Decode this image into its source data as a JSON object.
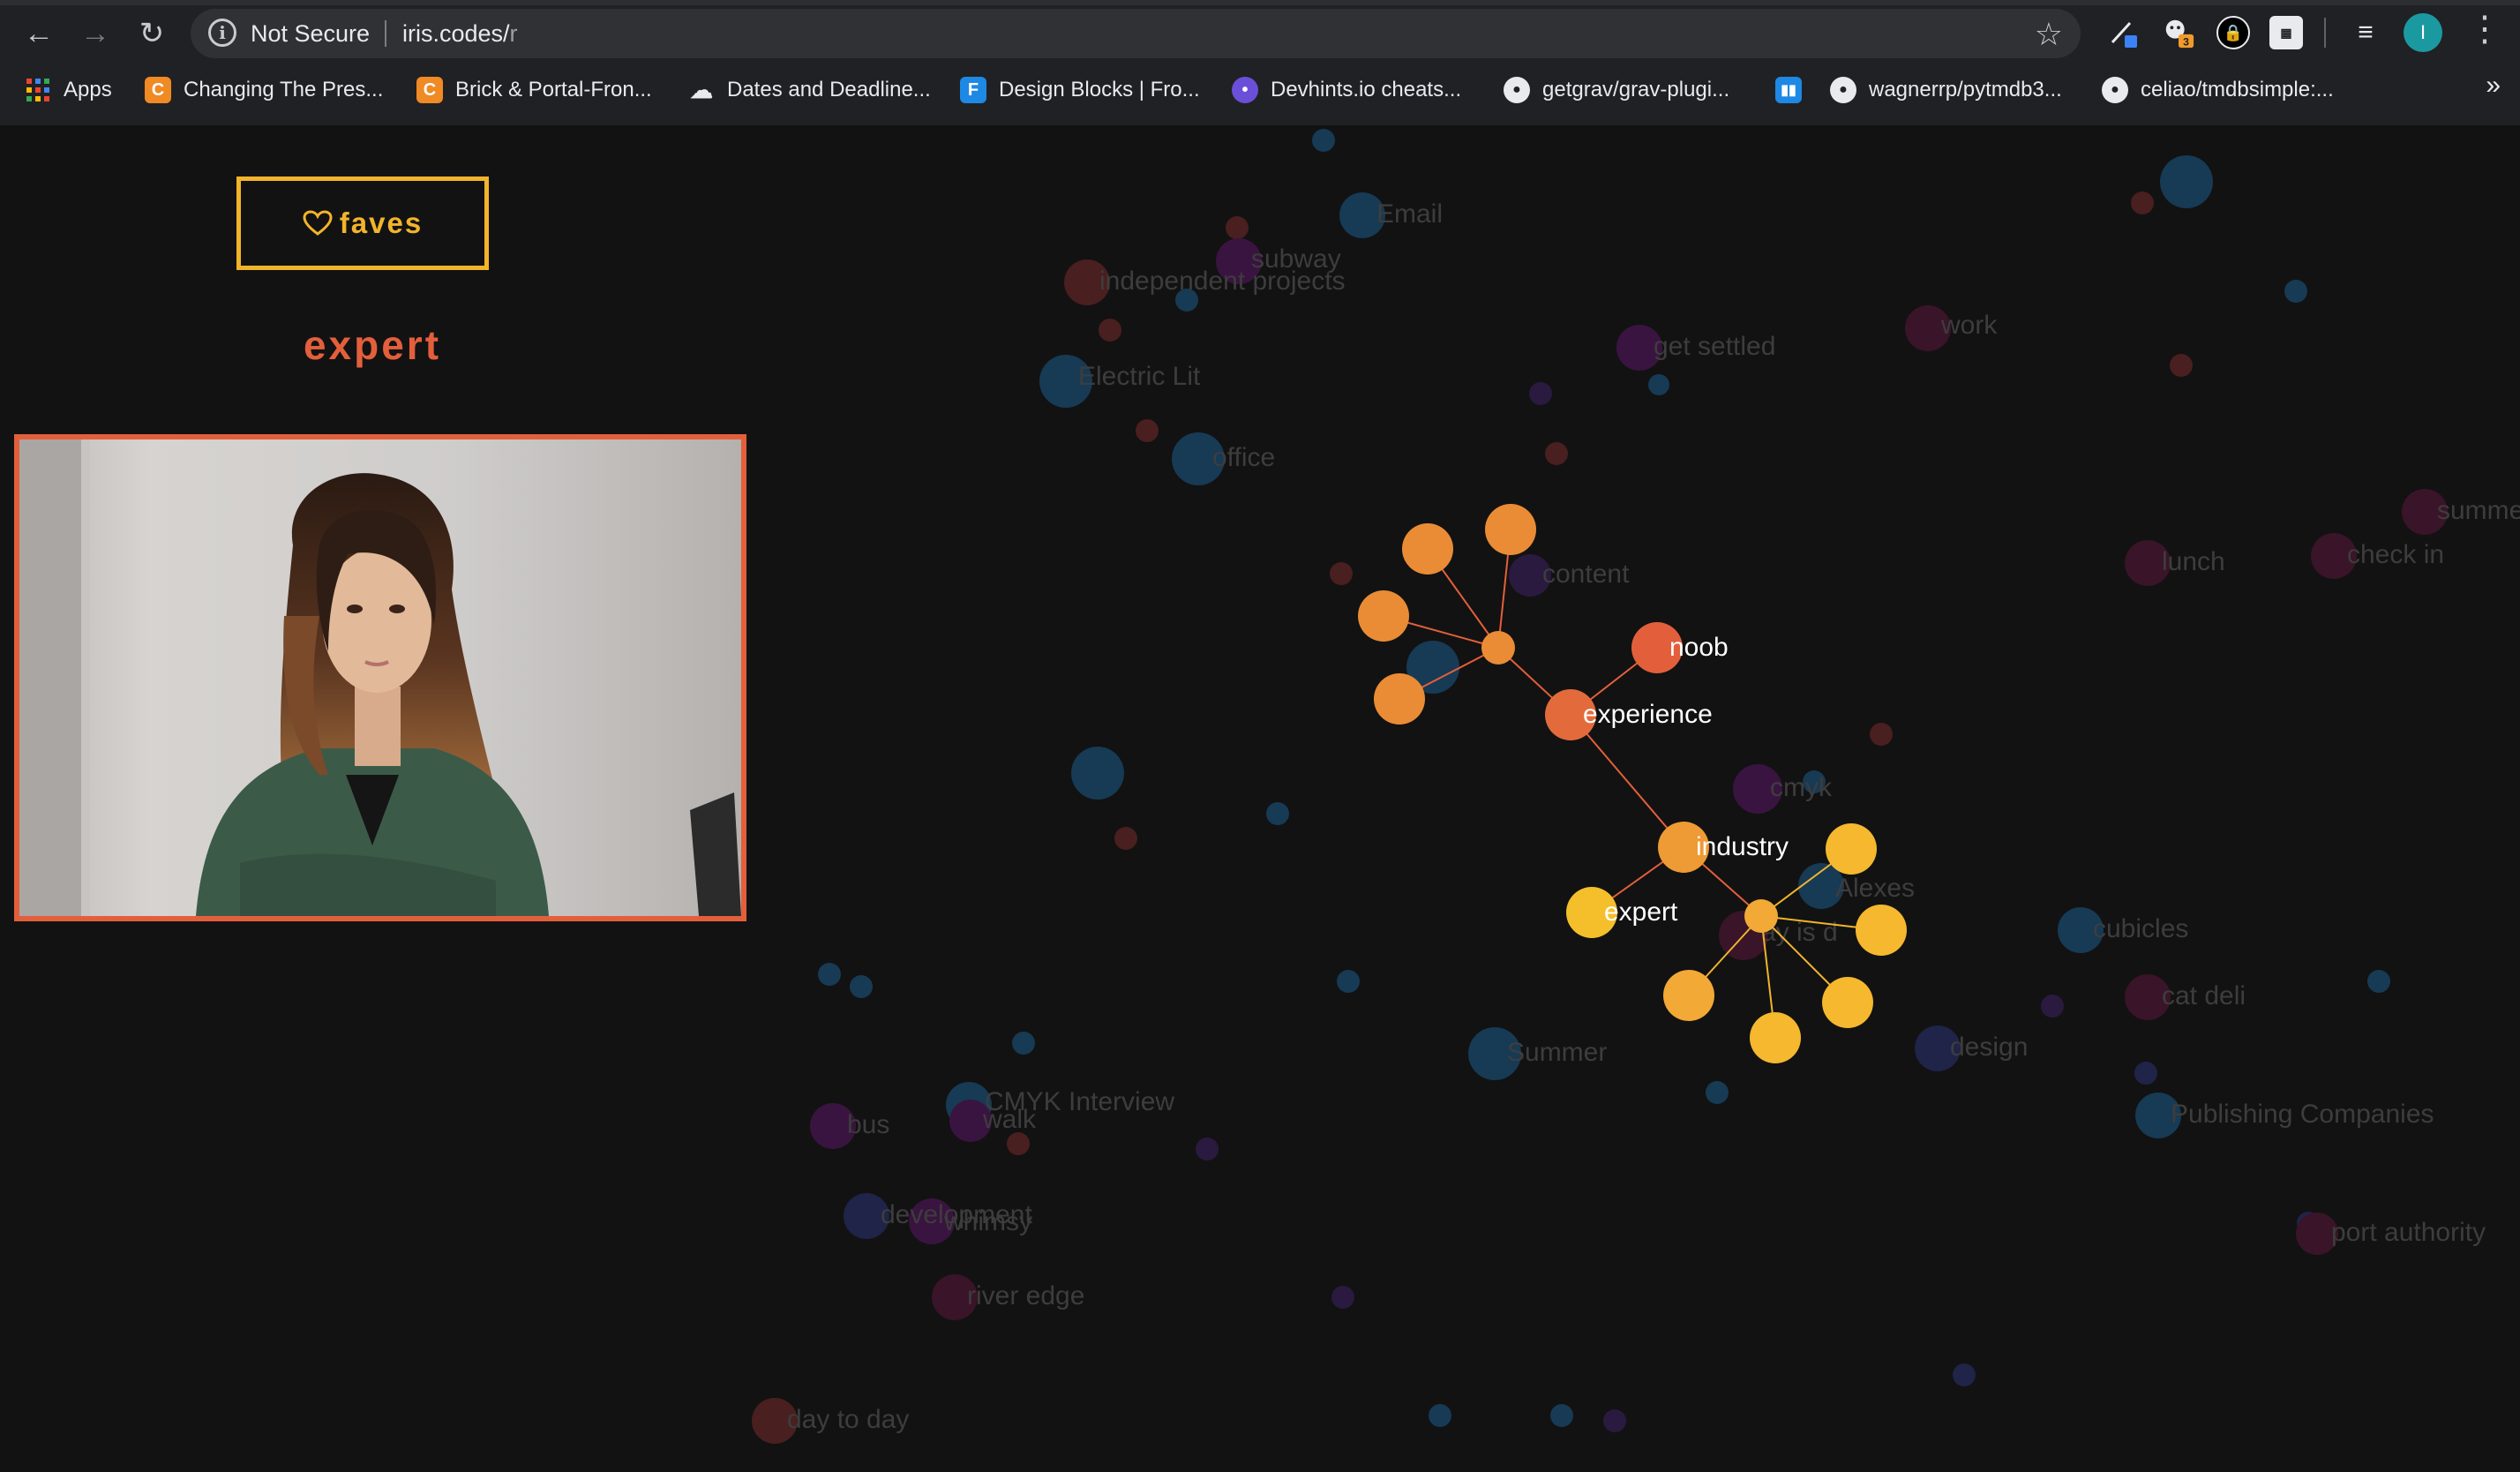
{
  "browser": {
    "security_status": "Not Secure",
    "url_host": "iris.codes/",
    "url_path": "r",
    "profile_initial": "I",
    "extension_badge": "3",
    "bookmarks": [
      {
        "label": "Apps",
        "icon": "apps-grid-icon"
      },
      {
        "label": "Changing The Pres...",
        "icon": "codepen-c-icon"
      },
      {
        "label": "Brick & Portal-Fron...",
        "icon": "codepen-c-icon"
      },
      {
        "label": "Dates and Deadline...",
        "icon": "cloud-icon"
      },
      {
        "label": "Design Blocks | Fro...",
        "icon": "f-square-icon"
      },
      {
        "label": "Devhints.io cheats...",
        "icon": "devhints-icon"
      },
      {
        "label": "getgrav/grav-plugi...",
        "icon": "github-icon"
      },
      {
        "label": "",
        "icon": "bar-chart-icon"
      },
      {
        "label": "wagnerrp/pytmdb3...",
        "icon": "github-icon"
      },
      {
        "label": "celiao/tmdbsimple:...",
        "icon": "github-icon"
      }
    ],
    "more_bookmarks": "»"
  },
  "page": {
    "faves_label": "faves",
    "selected_word": "expert",
    "accent_orange": "#e35f3b",
    "accent_yellow": "#f2b42b"
  },
  "graph": {
    "dim_labels": {
      "email": "Email",
      "subway": "subway",
      "independent_projects": "independent projects",
      "electric_lit": "Electric Lit",
      "office": "office",
      "get_settled": "get settled",
      "work": "work",
      "summer_right": "summe",
      "lunch": "lunch",
      "check_in": "check in",
      "content": "content",
      "cmyk": "cmyk",
      "alexes": "Alexes",
      "day_is": "ay is d",
      "cubicles": "cubicles",
      "cat_deli": "cat deli",
      "summer": "Summer",
      "design": "design",
      "publishing_companies": "Publishing Companies",
      "port_authority": "port authority",
      "cmyk_interview": "CMYK Interview",
      "walk": "walk",
      "bus": "bus",
      "development": "development",
      "whimsy": "whimsy",
      "river_edge": "river edge",
      "day_to_day": "day to day"
    },
    "active_labels": {
      "noob": "noob",
      "experience": "experience",
      "industry": "industry",
      "expert": "expert"
    }
  }
}
